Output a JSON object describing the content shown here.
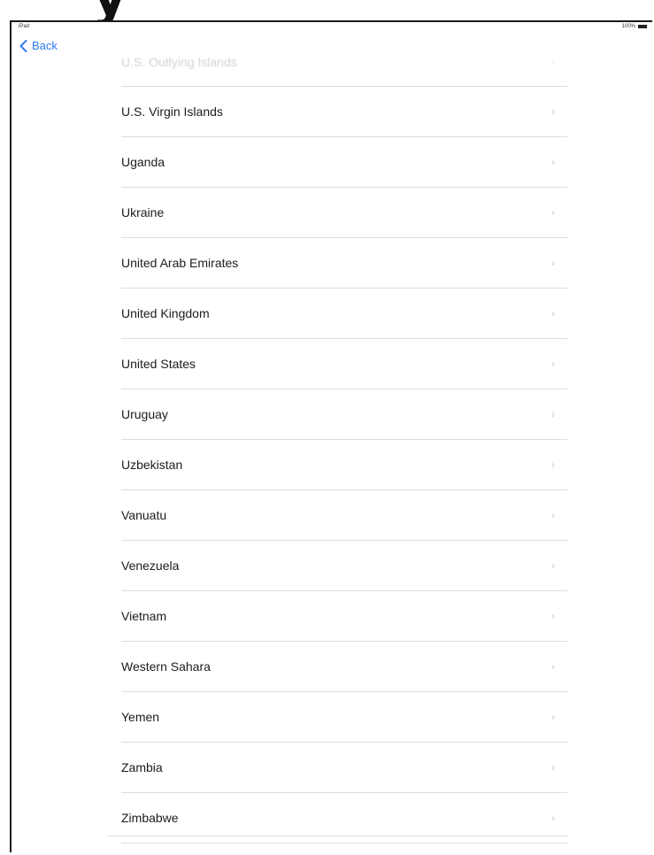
{
  "status": {
    "device": "iPad",
    "battery": "100%"
  },
  "nav": {
    "back_label": "Back"
  },
  "countries": [
    {
      "label": "U.S. Outlying Islands",
      "faded": true
    },
    {
      "label": "U.S. Virgin Islands"
    },
    {
      "label": "Uganda"
    },
    {
      "label": "Ukraine"
    },
    {
      "label": "United Arab Emirates"
    },
    {
      "label": "United Kingdom"
    },
    {
      "label": "United States"
    },
    {
      "label": "Uruguay"
    },
    {
      "label": "Uzbekistan"
    },
    {
      "label": "Vanuatu"
    },
    {
      "label": "Venezuela"
    },
    {
      "label": "Vietnam"
    },
    {
      "label": "Western Sahara"
    },
    {
      "label": "Yemen"
    },
    {
      "label": "Zambia"
    },
    {
      "label": "Zimbabwe"
    }
  ],
  "colors": {
    "accent": "#2f7cf6",
    "separator": "#dcdcdc",
    "chevron": "#c8c8c8"
  }
}
